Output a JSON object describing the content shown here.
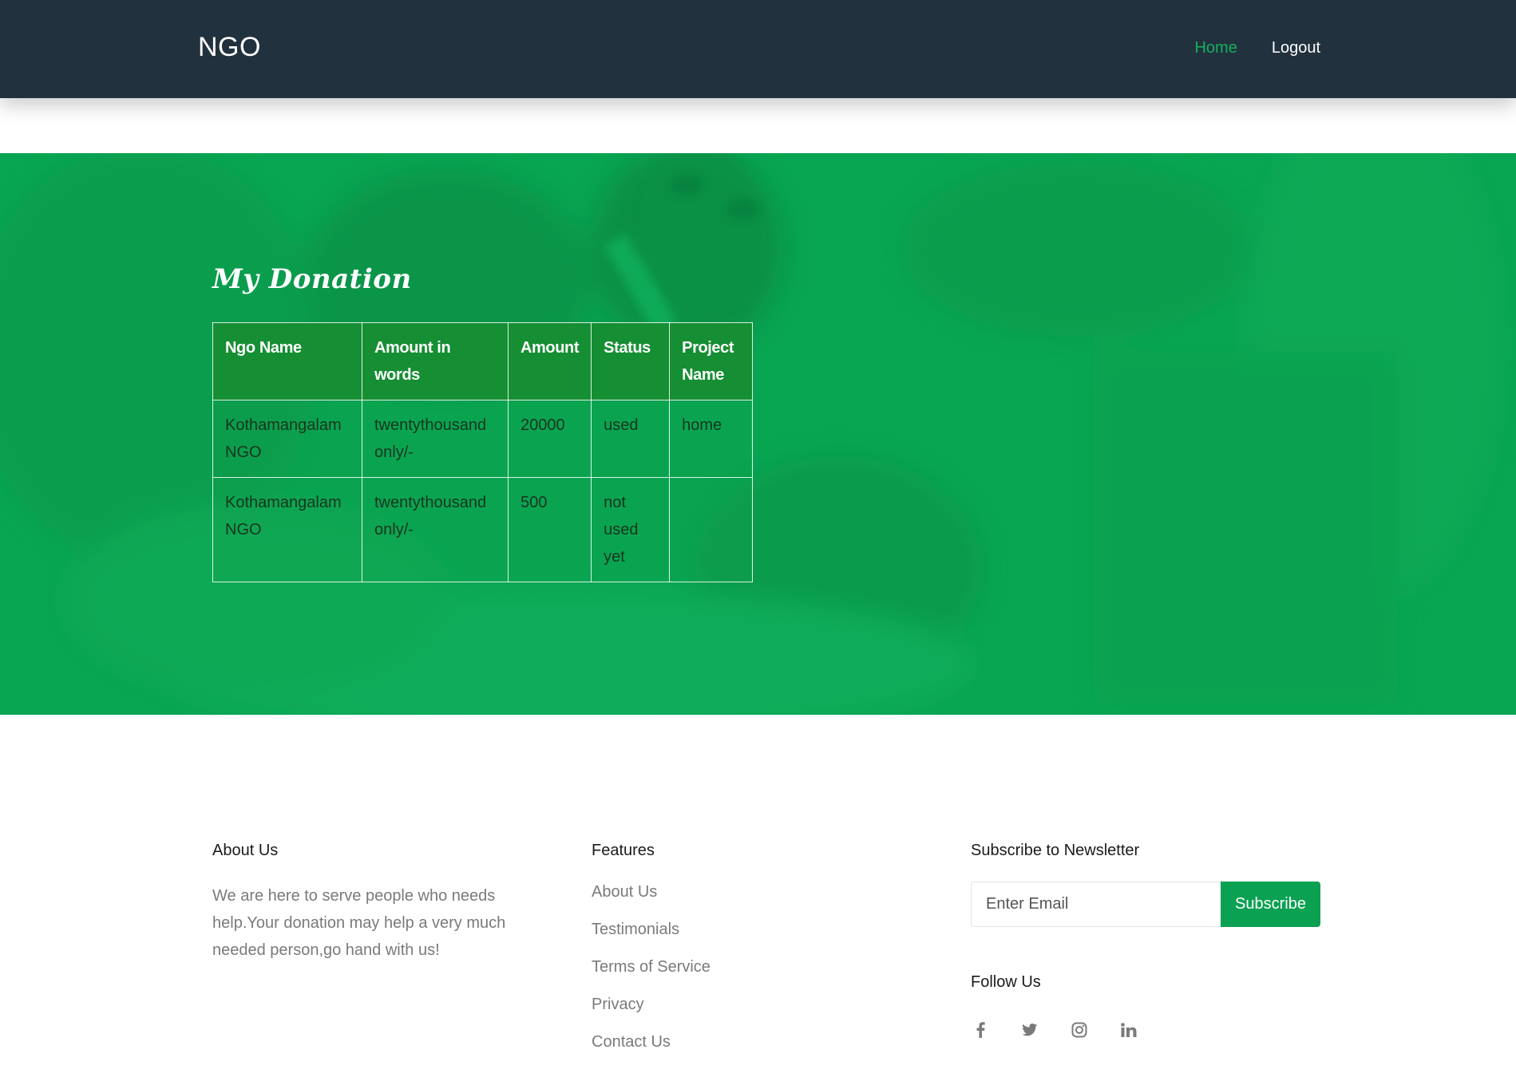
{
  "header": {
    "brand": "NGO",
    "nav": [
      {
        "label": "Home",
        "active": true
      },
      {
        "label": "Logout",
        "active": false
      }
    ]
  },
  "hero": {
    "title": "My Donation",
    "table": {
      "columns": [
        "Ngo Name",
        "Amount in words",
        "Amount",
        "Status",
        "Project Name"
      ],
      "rows": [
        [
          "Kothamangalam NGO",
          "twentythousand only/-",
          "20000",
          "used",
          "home"
        ],
        [
          "Kothamangalam NGO",
          "twentythousand only/-",
          "500",
          "not used yet",
          ""
        ]
      ]
    }
  },
  "footer": {
    "about": {
      "title": "About Us",
      "text": "We are here to serve people who needs help.Your donation may help a very much needed person,go hand with us!"
    },
    "features": {
      "title": "Features",
      "links": [
        "About Us",
        "Testimonials",
        "Terms of Service",
        "Privacy",
        "Contact Us"
      ]
    },
    "newsletter": {
      "title": "Subscribe to Newsletter",
      "email_placeholder": "Enter Email",
      "button_label": "Subscribe",
      "follow_title": "Follow Us",
      "social_icons": [
        "facebook-icon",
        "twitter-icon",
        "instagram-icon",
        "linkedin-icon"
      ]
    }
  },
  "colors": {
    "header_bg": "#22313e",
    "accent_green": "#0ba152",
    "nav_active": "#14b05f",
    "table_header_bg": "#168e33"
  }
}
